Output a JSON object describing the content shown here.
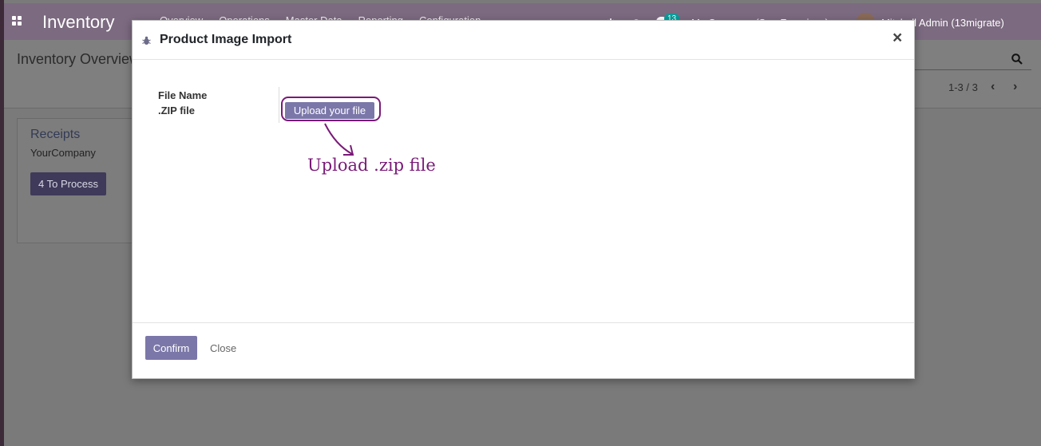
{
  "navbar": {
    "brand": "Inventory",
    "menu": [
      "Overview",
      "Operations",
      "Master Data",
      "Reporting",
      "Configuration"
    ],
    "chat_count": "13",
    "company": "My Company (San Francisco)",
    "user": "Mitchell Admin (13migrate)"
  },
  "control_panel": {
    "title": "Inventory Overview",
    "pager": "1-3 / 3"
  },
  "card": {
    "title": "Receipts",
    "company": "YourCompany",
    "button": "4 To Process"
  },
  "modal": {
    "title": "Product Image Import",
    "close_glyph": "×",
    "field_label_1": "File Name",
    "field_label_2": ".ZIP file",
    "upload_label": "Upload your file",
    "annotation": "Upload  .zip  file",
    "confirm_label": "Confirm",
    "close_label": "Close"
  },
  "colors": {
    "navbar": "#7c6a80",
    "primary_button": "#7b77a9",
    "annotation": "#7a1a78"
  }
}
